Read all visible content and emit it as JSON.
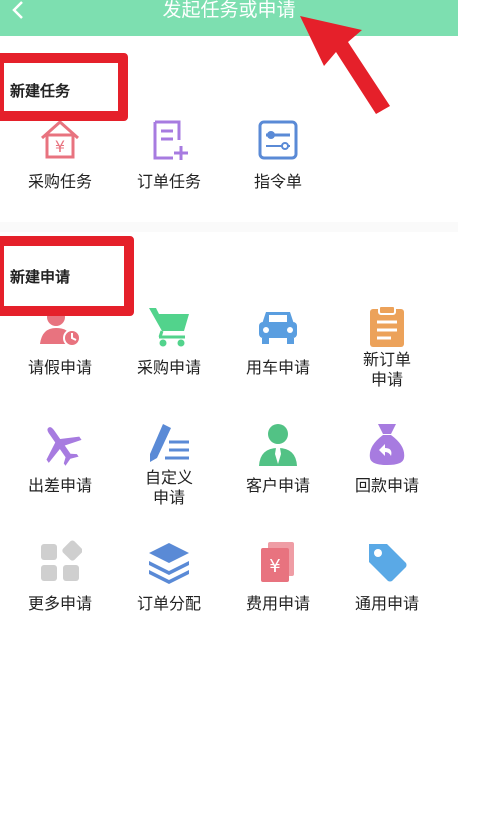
{
  "header": {
    "title": "发起任务或申请",
    "back_icon": "chevron-left-icon"
  },
  "sections": [
    {
      "title": "新建任务",
      "items": [
        {
          "label": "采购任务",
          "icon": "house-yen-icon"
        },
        {
          "label": "订单任务",
          "icon": "add-document-icon"
        },
        {
          "label": "指令单",
          "icon": "slider-panel-icon"
        }
      ]
    },
    {
      "title": "新建申请",
      "items": [
        {
          "label": "请假申请",
          "icon": "user-clock-icon"
        },
        {
          "label": "采购申请",
          "icon": "shopping-cart-icon"
        },
        {
          "label": "用车申请",
          "icon": "car-icon"
        },
        {
          "label": "新订单\n申请",
          "icon": "clipboard-icon"
        },
        {
          "label": "出差申请",
          "icon": "airplane-icon"
        },
        {
          "label": "自定义\n申请",
          "icon": "pen-list-icon"
        },
        {
          "label": "客户申请",
          "icon": "customer-icon"
        },
        {
          "label": "回款申请",
          "icon": "money-bag-icon"
        },
        {
          "label": "更多申请",
          "icon": "grid-icon"
        },
        {
          "label": "订单分配",
          "icon": "layers-icon"
        },
        {
          "label": "费用申请",
          "icon": "yen-cards-icon"
        },
        {
          "label": "通用申请",
          "icon": "tag-icon"
        }
      ]
    }
  ],
  "colors": {
    "header": "#7ddfb0",
    "annotation_red": "#e5202a"
  }
}
